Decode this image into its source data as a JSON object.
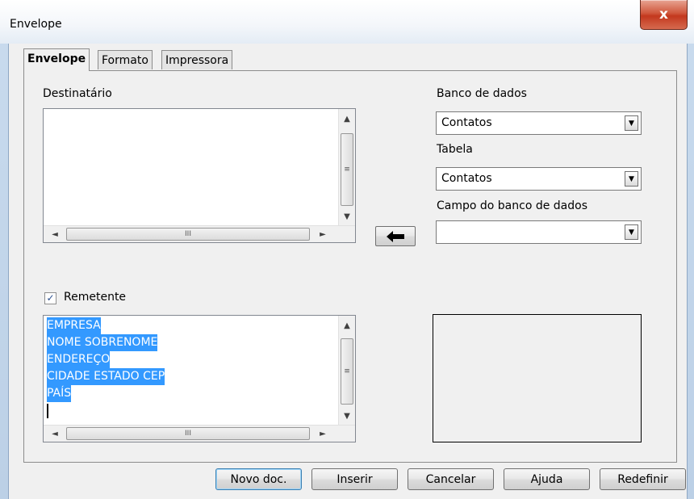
{
  "window": {
    "title": "Envelope",
    "close_label": "x"
  },
  "tabs": [
    {
      "label": "Envelope"
    },
    {
      "label": "Formato"
    },
    {
      "label": "Impressora"
    }
  ],
  "recipient": {
    "label": "Destinatário",
    "text": ""
  },
  "database": {
    "label": "Banco de dados",
    "value": "Contatos"
  },
  "table": {
    "label": "Tabela",
    "value": "Contatos"
  },
  "field": {
    "label": "Campo do banco de dados",
    "value": ""
  },
  "sender": {
    "checkbox_label": "Remetente",
    "checked": true,
    "lines": [
      "EMPRESA",
      "NOME SOBRENOME",
      "ENDEREÇO",
      "CIDADE ESTADO CEP",
      "PAÍS"
    ]
  },
  "scroll": {
    "grip": "≡",
    "hgrip": "III",
    "up": "▲",
    "down": "▼",
    "left": "◄",
    "right": "►"
  },
  "buttons": {
    "new_doc": "Novo doc.",
    "insert": "Inserir",
    "cancel": "Cancelar",
    "help": "Ajuda",
    "reset": "Redefinir"
  },
  "colors": {
    "selection": "#3399ff"
  }
}
